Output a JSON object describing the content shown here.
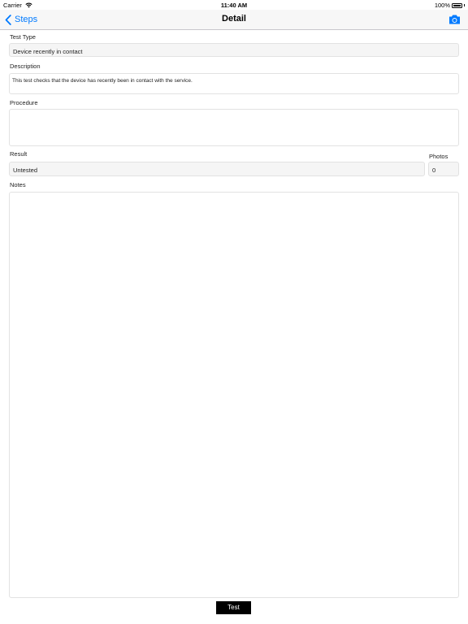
{
  "status_bar": {
    "carrier": "Carrier",
    "time": "11:40 AM",
    "battery": "100%",
    "icons": [
      "wifi-icon",
      "battery-icon"
    ]
  },
  "nav": {
    "back_label": "Steps",
    "title": "Detail",
    "back_icon": "chevron-left-icon",
    "camera_icon": "camera-icon",
    "accent_color": "#007aff"
  },
  "form": {
    "test_type": {
      "label": "Test Type",
      "value": "Device recently in contact"
    },
    "description": {
      "label": "Description",
      "value": "This test checks that the device has recently been in contact with the service."
    },
    "procedure": {
      "label": "Procedure",
      "value": ""
    },
    "result": {
      "label": "Result",
      "value": "Untested"
    },
    "photos": {
      "label": "Photos",
      "value": "0"
    },
    "notes": {
      "label": "Notes",
      "value": ""
    }
  },
  "actions": {
    "test_label": "Test"
  }
}
